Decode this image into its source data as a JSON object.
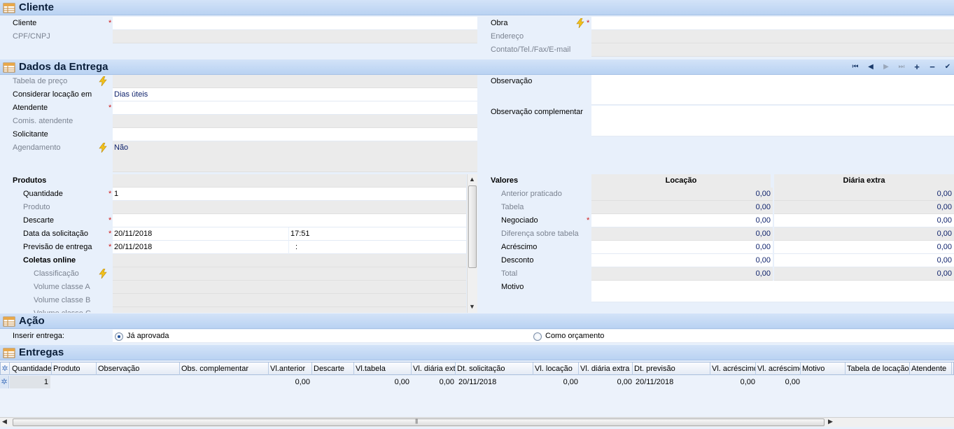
{
  "cliente": {
    "title": "Cliente",
    "cliente_label": "Cliente",
    "cpf_label": "CPF/CNPJ",
    "obra_label": "Obra",
    "endereco_label": "Endereço",
    "contato_label": "Contato/Tel./Fax/E-mail"
  },
  "entrega": {
    "title": "Dados da Entrega",
    "tabela_preco_label": "Tabela de preço",
    "considerar_label": "Considerar locação em",
    "considerar_value": "Dias úteis",
    "atendente_label": "Atendente",
    "comis_label": "Comis. atendente",
    "solicitante_label": "Solicitante",
    "agendamento_label": "Agendamento",
    "agendamento_value": "Não",
    "observacao_label": "Observação",
    "obs_comp_label": "Observação complementar",
    "nav": {
      "first": "⏮",
      "prev": "◀",
      "next": "▶",
      "last": "⏭",
      "add": "+",
      "remove": "−",
      "confirm": "✔"
    }
  },
  "produtos": {
    "header": "Produtos",
    "quantidade_label": "Quantidade",
    "quantidade_value": "1",
    "produto_label": "Produto",
    "descarte_label": "Descarte",
    "data_solic_label": "Data da solicitação",
    "data_solic_date": "20/11/2018",
    "data_solic_time": "17:51",
    "previsao_label": "Previsão de entrega",
    "previsao_date": "20/11/2018",
    "previsao_time": ":",
    "coletas_label": "Coletas online",
    "classificacao_label": "Classificação",
    "volume_a_label": "Volume classe A",
    "volume_b_label": "Volume classe B",
    "volume_c_label": "Volume classe C"
  },
  "valores": {
    "header": "Valores",
    "col_locacao": "Locação",
    "col_diaria": "Diária extra",
    "rows": [
      {
        "label": "Anterior praticado",
        "locacao": "0,00",
        "diaria": "0,00"
      },
      {
        "label": "Tabela",
        "locacao": "0,00",
        "diaria": "0,00"
      },
      {
        "label": "Negociado",
        "locacao": "0,00",
        "diaria": "0,00"
      },
      {
        "label": "Diferença sobre tabela",
        "locacao": "0,00",
        "diaria": "0,00"
      },
      {
        "label": "Acréscimo",
        "locacao": "0,00",
        "diaria": "0,00"
      },
      {
        "label": "Desconto",
        "locacao": "0,00",
        "diaria": "0,00"
      },
      {
        "label": "Total",
        "locacao": "0,00",
        "diaria": "0,00"
      }
    ],
    "motivo_label": "Motivo"
  },
  "acao": {
    "title": "Ação",
    "inserir_label": "Inserir entrega:",
    "option_aprovada": "Já aprovada",
    "option_orcamento": "Como orçamento"
  },
  "entregas": {
    "title": "Entregas",
    "columns": [
      "Quantidade",
      "Produto",
      "Observação",
      "Obs. complementar",
      "Vl.anterior",
      "Descarte",
      "Vl.tabela",
      "Vl. diária ext",
      "Dt. solicitação",
      "Vl. locação",
      "Vl. diária extra",
      "Dt. previsão",
      "Vl. acréscimo",
      "Vl. acréscimo",
      "Motivo",
      "Tabela de locação",
      "Atendente"
    ],
    "row": {
      "quantidade": "1",
      "vl_anterior": "0,00",
      "vl_tabela": "0,00",
      "vl_diaria_ext": "0,00",
      "dt_solicitacao": "20/11/2018",
      "vl_locacao": "0,00",
      "vl_diaria_extra": "0,00",
      "dt_previsao": "20/11/2018",
      "vl_acrescimo": "0,00",
      "vl_acrescimo2": "0,00"
    }
  },
  "colors": {
    "header_bg": "#c5dbf5",
    "required": "#d01818",
    "value_text": "#0b1f6a",
    "disabled_text": "#7b8391"
  }
}
